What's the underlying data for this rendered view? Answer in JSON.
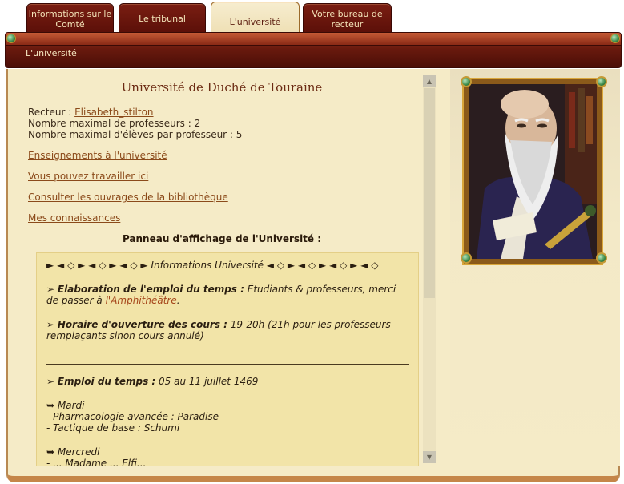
{
  "tabs": [
    {
      "label": "Informations sur le Comté"
    },
    {
      "label": "Le tribunal"
    },
    {
      "label": "L'université"
    },
    {
      "label": "Votre bureau de recteur"
    }
  ],
  "breadcrumb": {
    "label": "L'université"
  },
  "main": {
    "title": "Université de Duché de Touraine",
    "rector_label": "Recteur : ",
    "rector_name": "Elisabeth_stilton",
    "max_professors": "Nombre maximal de professeurs : 2",
    "max_students": "Nombre maximal d'élèves par professeur : 5",
    "links": [
      {
        "label": "Enseignements à l'université"
      },
      {
        "label": "Vous pouvez travailler ici"
      },
      {
        "label": "Consulter les ouvrages de la bibliothèque"
      },
      {
        "label": "Mes connaissances"
      }
    ],
    "board_title": "Panneau d'affichage de l'Université :"
  },
  "board": {
    "header": "► ◄ ◇ ► ◄ ◇ ► ◄ ◇ ► Informations Université ◄ ◇ ► ◄ ◇ ► ◄ ◇ ► ◄ ◇",
    "p1_bullet": "➢ ",
    "p1_bold": "Elaboration de l'emploi du temps :",
    "p1_text": " Étudiants & professeurs, merci de passer à ",
    "p1_link": "l'Amphithéâtre",
    "p1_end": ".",
    "p2_bullet": "➢ ",
    "p2_bold": "Horaire d'ouverture des cours :",
    "p2_text": " 19-20h (21h pour les professeurs remplaçants sinon cours annulé)",
    "p3_bullet": "➢ ",
    "p3_bold": "Emploi du temps :",
    "p3_text": " 05 au 11 juillet 1469",
    "day1": "➥ Mardi",
    "day1_l1": "- Pharmacologie avancée : Paradise",
    "day1_l2": "- Tactique de base : Schumi",
    "day2": "➥ Mercredi",
    "day2_l1": "- ... Madame ... Elfi..."
  }
}
